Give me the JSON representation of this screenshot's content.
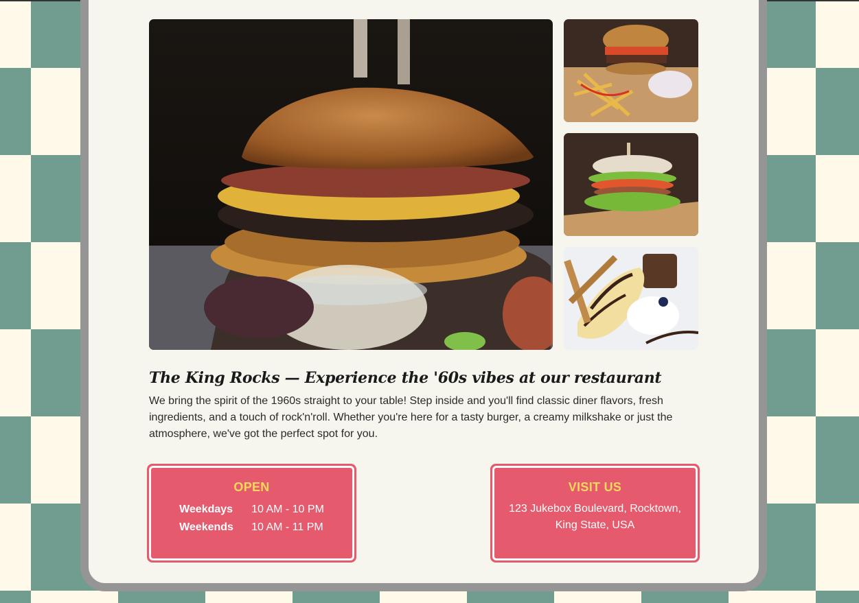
{
  "restaurant": {
    "headline": "The King Rocks — Experience the '60s vibes at our restaurant",
    "intro": "We bring the spirit of the 1960s straight to your table! Step inside and you'll find classic diner flavors, fresh ingredients, and a touch of rock'n'roll. Whether you're here for a tasty burger, a creamy milkshake or just the atmosphere, we've got the perfect spot for you."
  },
  "open": {
    "title": "OPEN",
    "rows": [
      {
        "day": "Weekdays",
        "hours": "10 AM - 10 PM"
      },
      {
        "day": "Weekends",
        "hours": "10 AM - 11 PM"
      }
    ]
  },
  "visit": {
    "title": "VISIT US",
    "address": "123 Jukebox Boulevard, Rocktown, King State, USA"
  },
  "colors": {
    "accent_pink": "#e65a6d",
    "title_yellow": "#f8d95a",
    "checker_teal": "#719d91",
    "checker_cream": "#fff9ea",
    "card_bg": "#f6f6ee",
    "card_border": "#959595"
  },
  "images": {
    "main": "burger-photo",
    "side1": "burger-and-fries-photo",
    "side2": "sandwich-photo",
    "side3": "banana-split-dessert-photo"
  }
}
